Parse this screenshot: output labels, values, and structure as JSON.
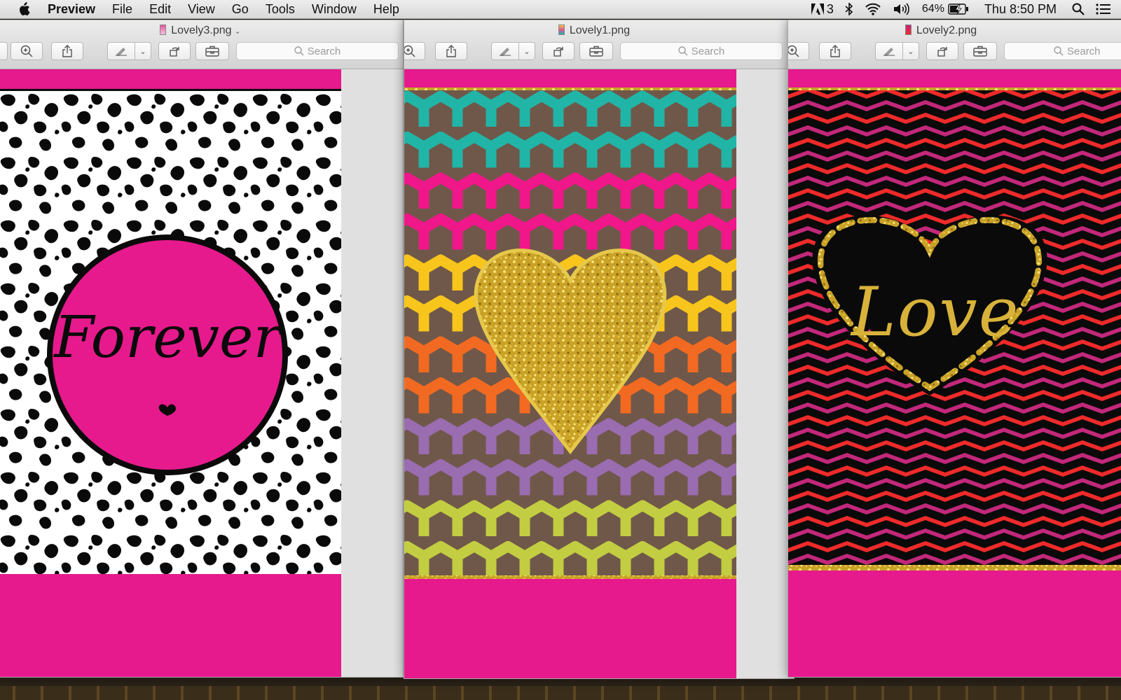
{
  "menubar": {
    "app_name": "Preview",
    "items": [
      "File",
      "Edit",
      "View",
      "Go",
      "Tools",
      "Window",
      "Help"
    ],
    "adobe_badge": "3",
    "battery": "64%",
    "clock": "Thu 8:50 PM"
  },
  "windows": [
    {
      "title": "Lovely3.png",
      "search_placeholder": "Search",
      "art_text": "Forever"
    },
    {
      "title": "Lovely1.png",
      "search_placeholder": "Search"
    },
    {
      "title": "Lovely2.png",
      "search_placeholder": "Search",
      "art_text": "Love"
    }
  ],
  "colors": {
    "page_pink": "#e61a8d",
    "gold": "#d4aa2a",
    "chevron_red": "#ee2a2a",
    "chevron_magenta": "#c2287a",
    "stripe_bands": [
      "#21b5a8",
      "#f0178a",
      "#f8c51c",
      "#f26a22",
      "#9a6cb0",
      "#c3cd41"
    ],
    "stripe_brown": "#6f5849"
  },
  "icons": [
    "apple-icon",
    "adobe-icon",
    "bluetooth-icon",
    "wifi-icon",
    "volume-icon",
    "battery-icon",
    "spotlight-icon",
    "notification-center-icon",
    "zoom-in-icon",
    "share-icon",
    "markup-pen-icon",
    "chevron-down-icon",
    "rotate-icon",
    "toolbox-icon",
    "search-icon"
  ]
}
